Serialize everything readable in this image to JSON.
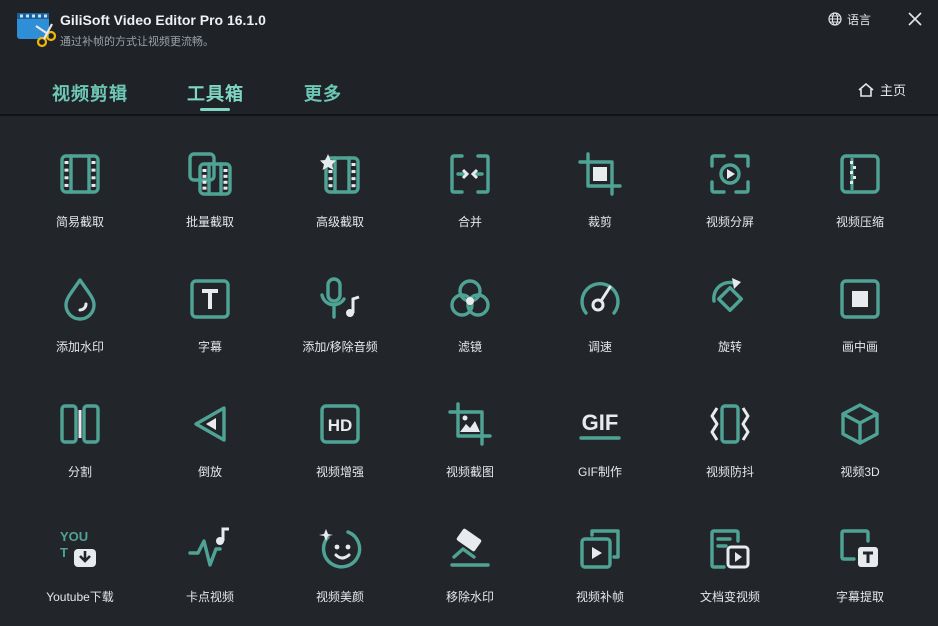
{
  "window": {
    "title": "GiliSoft Video Editor Pro 16.1.0",
    "subtitle": "通过补帧的方式让视频更流畅。",
    "language_label": "语言"
  },
  "tabs": [
    {
      "label": "视频剪辑",
      "active": false
    },
    {
      "label": "工具箱",
      "active": true
    },
    {
      "label": "更多",
      "active": false
    }
  ],
  "home_label": "主页",
  "colors": {
    "accent": "#4fa395",
    "tab_text": "#7fd6c3",
    "background": "#22262b"
  },
  "tools": [
    {
      "label": "简易截取",
      "icon": "film-icon"
    },
    {
      "label": "批量截取",
      "icon": "batch-film-icon"
    },
    {
      "label": "高级截取",
      "icon": "star-film-icon"
    },
    {
      "label": "合并",
      "icon": "merge-icon"
    },
    {
      "label": "裁剪",
      "icon": "crop-icon"
    },
    {
      "label": "视频分屏",
      "icon": "split-screen-icon"
    },
    {
      "label": "视频压缩",
      "icon": "compress-icon"
    },
    {
      "label": "添加水印",
      "icon": "watermark-drop-icon"
    },
    {
      "label": "字幕",
      "icon": "text-icon"
    },
    {
      "label": "添加/移除音频",
      "icon": "mic-music-icon"
    },
    {
      "label": "滤镜",
      "icon": "filter-circles-icon"
    },
    {
      "label": "调速",
      "icon": "speedometer-icon"
    },
    {
      "label": "旋转",
      "icon": "rotate-icon"
    },
    {
      "label": "画中画",
      "icon": "picture-in-picture-icon"
    },
    {
      "label": "分割",
      "icon": "split-icon"
    },
    {
      "label": "倒放",
      "icon": "reverse-play-icon"
    },
    {
      "label": "视频增强",
      "icon": "hd-icon"
    },
    {
      "label": "视频截图",
      "icon": "screenshot-image-icon"
    },
    {
      "label": "GIF制作",
      "icon": "gif-icon"
    },
    {
      "label": "视频防抖",
      "icon": "stabilize-icon"
    },
    {
      "label": "视频3D",
      "icon": "cube-3d-icon"
    },
    {
      "label": "Youtube下载",
      "icon": "youtube-download-icon"
    },
    {
      "label": "卡点视频",
      "icon": "beat-wave-icon"
    },
    {
      "label": "视频美颜",
      "icon": "beauty-face-icon"
    },
    {
      "label": "移除水印",
      "icon": "eraser-icon"
    },
    {
      "label": "视频补帧",
      "icon": "frame-interpolation-icon"
    },
    {
      "label": "文档变视频",
      "icon": "doc-to-video-icon"
    },
    {
      "label": "字幕提取",
      "icon": "subtitle-extract-icon"
    }
  ]
}
